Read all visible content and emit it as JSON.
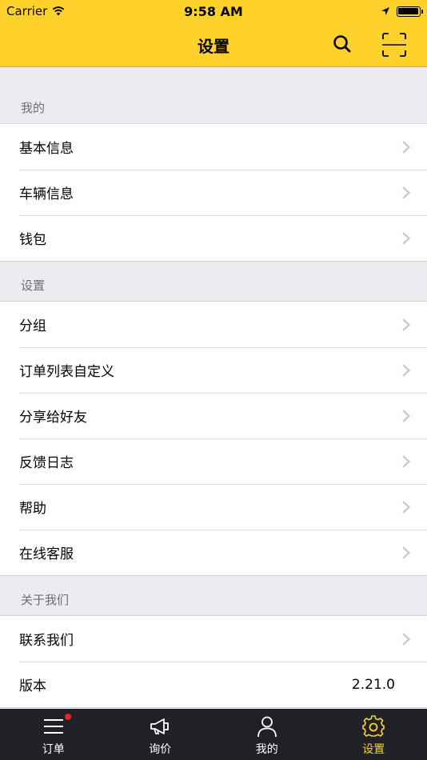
{
  "status_bar": {
    "carrier": "Carrier",
    "time": "9:58 AM"
  },
  "nav": {
    "title": "设置",
    "search_icon": "search-icon",
    "scan_icon": "scan-icon"
  },
  "sections": [
    {
      "header": "我的",
      "items": [
        {
          "label": "基本信息"
        },
        {
          "label": "车辆信息"
        },
        {
          "label": "钱包"
        }
      ]
    },
    {
      "header": "设置",
      "items": [
        {
          "label": "分组"
        },
        {
          "label": "订单列表自定义"
        },
        {
          "label": "分享给好友"
        },
        {
          "label": "反馈日志"
        },
        {
          "label": "帮助"
        },
        {
          "label": "在线客服"
        }
      ]
    },
    {
      "header": "关于我们",
      "items": [
        {
          "label": "联系我们"
        },
        {
          "label": "版本",
          "value": "2.21.0"
        }
      ]
    }
  ],
  "tabbar": {
    "tabs": [
      {
        "label": "订单",
        "icon": "menu-list-icon",
        "badge": true
      },
      {
        "label": "询价",
        "icon": "megaphone-icon"
      },
      {
        "label": "我的",
        "icon": "person-icon"
      },
      {
        "label": "设置",
        "icon": "gear-icon",
        "active": true
      }
    ]
  },
  "colors": {
    "accent": "#fed22a",
    "tabbar_bg": "#1f2126",
    "badge": "#e8262d"
  }
}
